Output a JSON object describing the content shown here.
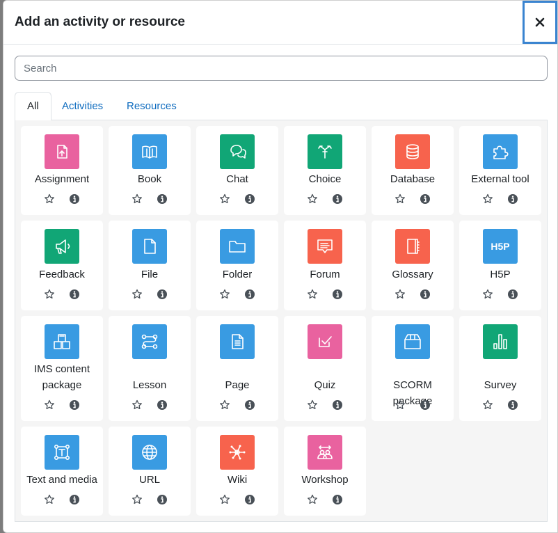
{
  "modal": {
    "title": "Add an activity or resource",
    "close_label": "×"
  },
  "search": {
    "placeholder": "Search",
    "value": ""
  },
  "tabs": [
    {
      "label": "All",
      "active": true
    },
    {
      "label": "Activities",
      "active": false
    },
    {
      "label": "Resources",
      "active": false
    }
  ],
  "colors": {
    "pink": "#e9629f",
    "blue": "#399be2",
    "green": "#11a676",
    "red": "#f7634d",
    "link": "#0f6cbf"
  },
  "items": [
    {
      "name": "Assignment",
      "color": "pink",
      "icon": "assignment-icon"
    },
    {
      "name": "Book",
      "color": "blue",
      "icon": "book-icon"
    },
    {
      "name": "Chat",
      "color": "green",
      "icon": "chat-icon"
    },
    {
      "name": "Choice",
      "color": "green",
      "icon": "choice-icon"
    },
    {
      "name": "Database",
      "color": "red",
      "icon": "database-icon"
    },
    {
      "name": "External tool",
      "color": "blue",
      "icon": "puzzle-icon"
    },
    {
      "name": "Feedback",
      "color": "green",
      "icon": "megaphone-icon"
    },
    {
      "name": "File",
      "color": "blue",
      "icon": "file-icon"
    },
    {
      "name": "Folder",
      "color": "blue",
      "icon": "folder-icon"
    },
    {
      "name": "Forum",
      "color": "red",
      "icon": "forum-icon"
    },
    {
      "name": "Glossary",
      "color": "red",
      "icon": "glossary-icon"
    },
    {
      "name": "H5P",
      "color": "blue",
      "icon": "h5p-icon",
      "icon_text": "H5P"
    },
    {
      "name": "IMS content package",
      "color": "blue",
      "icon": "package-icon"
    },
    {
      "name": "Lesson",
      "color": "blue",
      "icon": "lesson-icon"
    },
    {
      "name": "Page",
      "color": "blue",
      "icon": "page-icon"
    },
    {
      "name": "Quiz",
      "color": "pink",
      "icon": "quiz-icon"
    },
    {
      "name": "SCORM package",
      "color": "blue",
      "icon": "scorm-icon"
    },
    {
      "name": "Survey",
      "color": "green",
      "icon": "survey-icon"
    },
    {
      "name": "Text and media",
      "color": "blue",
      "icon": "text-media-icon"
    },
    {
      "name": "URL",
      "color": "blue",
      "icon": "globe-icon"
    },
    {
      "name": "Wiki",
      "color": "red",
      "icon": "wiki-icon"
    },
    {
      "name": "Workshop",
      "color": "pink",
      "icon": "workshop-icon"
    }
  ]
}
